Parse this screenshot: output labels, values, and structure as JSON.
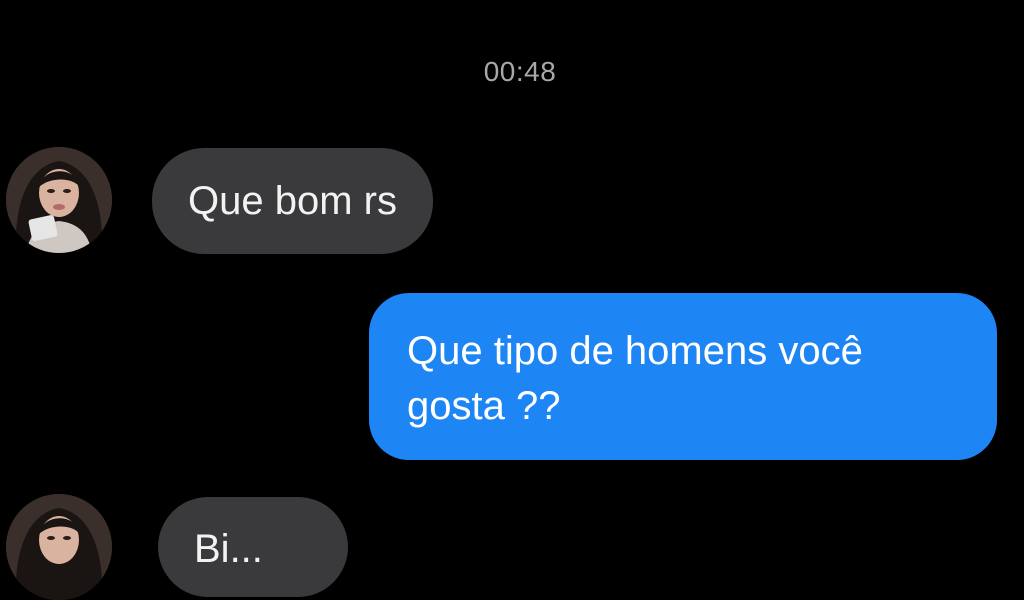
{
  "conversation": {
    "timestamp": "00:48",
    "messages": [
      {
        "direction": "incoming",
        "text": "Que bom rs"
      },
      {
        "direction": "outgoing",
        "lines": [
          "Que tipo de homens você",
          "gosta ??"
        ]
      },
      {
        "direction": "incoming",
        "text": "Bi..."
      }
    ]
  },
  "colors": {
    "background": "#000000",
    "incoming_bubble": "#3a3a3c",
    "outgoing_bubble": "#1e85f5",
    "timestamp_text": "#a8a8a8"
  }
}
